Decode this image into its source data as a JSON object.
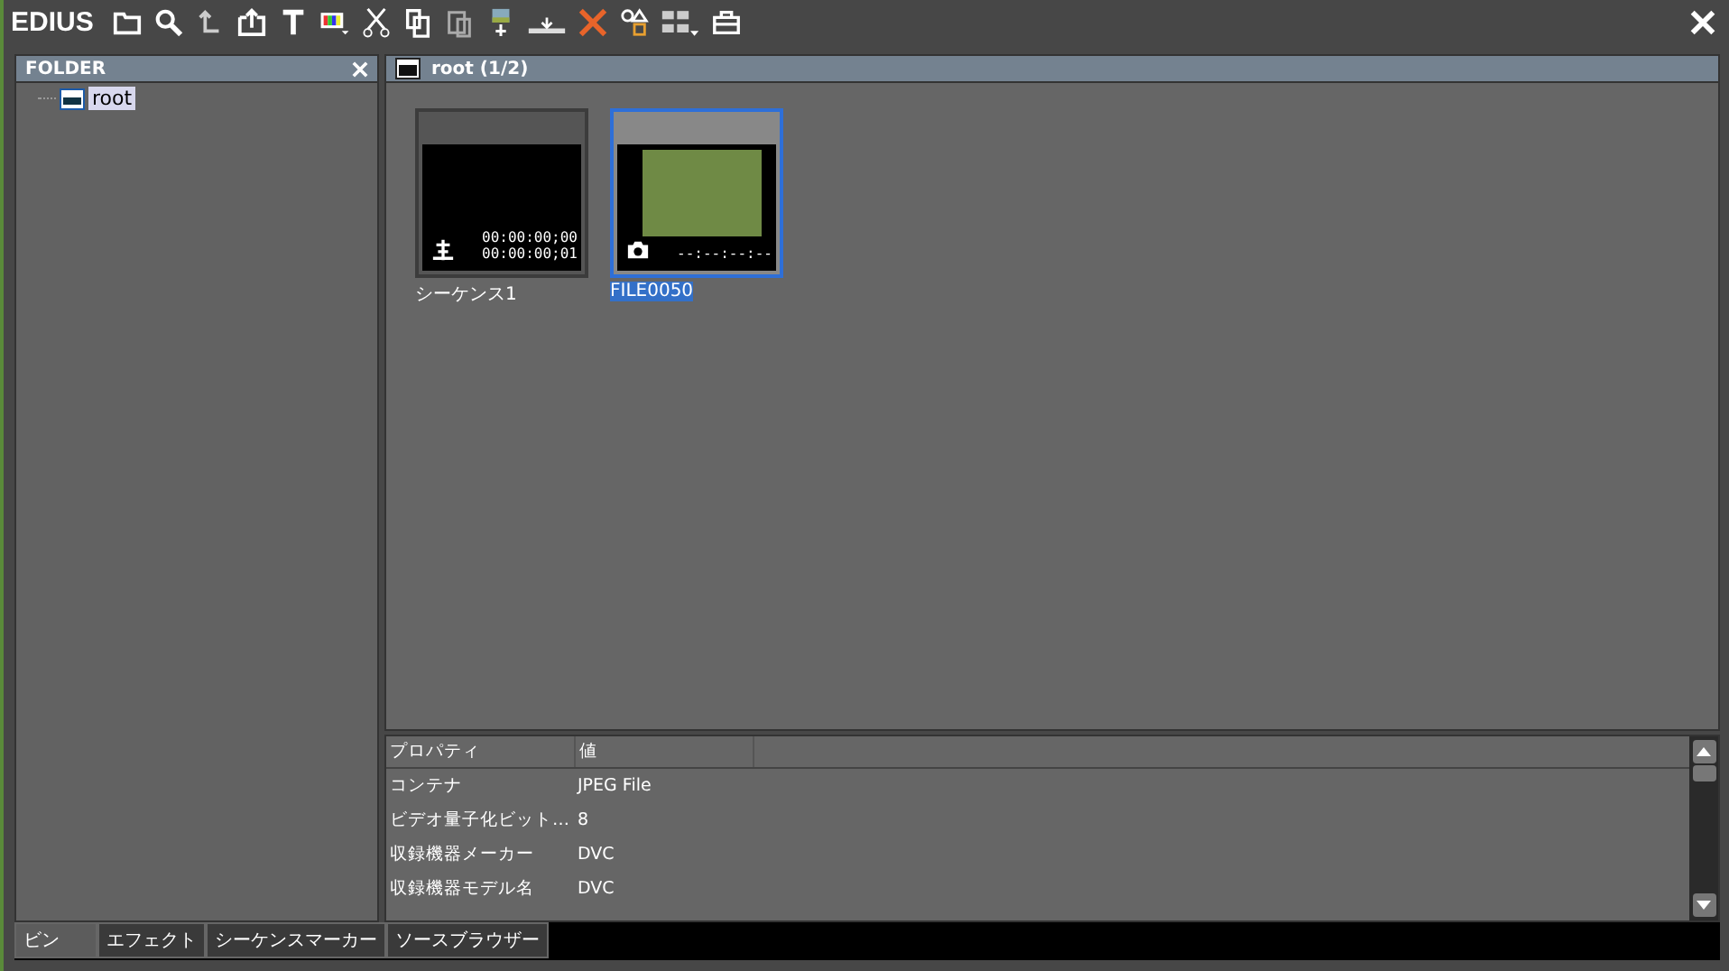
{
  "app_title": "EDIUS",
  "folder_panel": {
    "title": "FOLDER",
    "tree": [
      {
        "label": "root",
        "selected": true
      }
    ]
  },
  "bin": {
    "title": "root (1/2)",
    "clips": [
      {
        "name": "シーケンス1",
        "kind": "sequence",
        "selected": false,
        "timecode_in": "00:00:00;00",
        "timecode_out": "00:00:00;01"
      },
      {
        "name": "FILE0050",
        "kind": "still",
        "selected": true,
        "timecode_in": "--:--:--:--"
      }
    ]
  },
  "properties": {
    "columns": [
      "プロパティ",
      "値"
    ],
    "rows": [
      {
        "property": "コンテナ",
        "value": "JPEG File"
      },
      {
        "property": "ビデオ量子化ビット…",
        "value": "8"
      },
      {
        "property": "収録機器メーカー",
        "value": "DVC"
      },
      {
        "property": "収録機器モデル名",
        "value": "DVC"
      }
    ]
  },
  "tabs": [
    {
      "label": "ビン",
      "selected": true
    },
    {
      "label": "エフェクト",
      "selected": false
    },
    {
      "label": "シーケンスマーカー",
      "selected": false
    },
    {
      "label": "ソースブラウザー",
      "selected": false
    }
  ]
}
